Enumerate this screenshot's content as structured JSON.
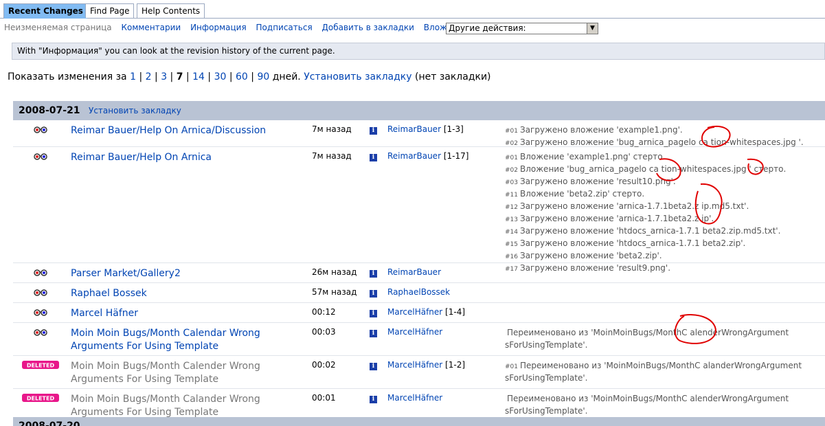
{
  "tabs": [
    "Recent Changes",
    "Find Page",
    "Help Contents"
  ],
  "actions": {
    "immutable": "Неизменяемая страница",
    "comments": "Комментарии",
    "info": "Информация",
    "subscribe": "Подписаться",
    "bookmark": "Добавить в закладки",
    "attachments": "Вложения",
    "more_actions": "Другие действия:"
  },
  "infobox": "With \"Информация\" you can look at the revision history of the current page.",
  "showline": {
    "prefix": "Показать изменения за",
    "days": [
      "1",
      "2",
      "3",
      "7",
      "14",
      "30",
      "60",
      "90"
    ],
    "current": "7",
    "suffix": "дней.",
    "set_bookmark": "Установить закладку",
    "no_bookmark": "(нет закладки)"
  },
  "day": {
    "date": "2008-07-21",
    "bookmark": "Установить закладку"
  },
  "rows": [
    {
      "title": "Reimar Bauer/Help On Arnica/Discussion",
      "deleted": false,
      "time": "7м назад",
      "editor": "ReimarBauer",
      "range": "[1-3]",
      "comments": [
        {
          "num": "#01",
          "text": "Загружено вложение 'example1.png'."
        },
        {
          "num": "#02",
          "text": "Загружено вложение 'bug_arnica_pagelo ca tion-whitespaces.jpg '."
        }
      ]
    },
    {
      "title": "Reimar Bauer/Help On Arnica",
      "deleted": false,
      "time": "7м назад",
      "editor": "ReimarBauer",
      "range": "[1-17]",
      "comments": [
        {
          "num": "#01",
          "text": "Вложение 'example1.png' стерто."
        },
        {
          "num": "#02",
          "text": "Вложение 'bug_arnica_pagelo ca tion-whitespaces.jpg ' стерто."
        },
        {
          "num": "#03",
          "text": "Загружено вложение 'result10.png'."
        },
        {
          "num": "#11",
          "text": "Вложение 'beta2.zip' стерто."
        },
        {
          "num": "#12",
          "text": "Загружено вложение 'arnica-1.7.1beta2.z ip.md5.txt'."
        },
        {
          "num": "#13",
          "text": "Загружено вложение 'arnica-1.7.1beta2.z ip'."
        },
        {
          "num": "#14",
          "text": "Загружено вложение 'htdocs_arnica-1.7.1 beta2.zip.md5.txt'."
        },
        {
          "num": "#15",
          "text": "Загружено вложение 'htdocs_arnica-1.7.1 beta2.zip'."
        },
        {
          "num": "#16",
          "text": "Загружено вложение 'beta2.zip'."
        },
        {
          "num": "#17",
          "text": "Загружено вложение 'result9.png'."
        }
      ]
    },
    {
      "title": "Parser Market/Gallery2",
      "deleted": false,
      "time": "26м назад",
      "editor": "ReimarBauer",
      "range": "",
      "comments": []
    },
    {
      "title": "Raphael Bossek",
      "deleted": false,
      "time": "57м назад",
      "editor": "RaphaelBossek",
      "range": "",
      "comments": []
    },
    {
      "title": "Marcel Häfner",
      "deleted": false,
      "time": "00:12",
      "editor": "MarcelHäfner",
      "range": "[1-4]",
      "comments": []
    },
    {
      "title": "Moin Moin Bugs/Month Calendar Wrong Arguments For Using Template",
      "deleted": false,
      "time": "00:03",
      "editor": "MarcelHäfner",
      "range": "",
      "comments": [
        {
          "num": "",
          "text": "Переименовано из 'MoinMoinBugs/MonthC alenderWrongArgument sForUsingTemplate'."
        }
      ]
    },
    {
      "title": "Moin Moin Bugs/Month Calender Wrong Arguments For Using Template",
      "deleted": true,
      "time": "00:02",
      "editor": "MarcelHäfner",
      "range": "[1-2]",
      "comments": [
        {
          "num": "#01",
          "text": "Переименовано из 'MoinMoinBugs/MonthC alanderWrongArgument sForUsingTemplate'."
        }
      ]
    },
    {
      "title": "Moin Moin Bugs/Month Calander Wrong Arguments For Using Template",
      "deleted": true,
      "time": "00:01",
      "editor": "MarcelHäfner",
      "range": "",
      "comments": [
        {
          "num": "",
          "text": "Переименовано из 'MoinMoinBugs/MonthC alenderWrongArgument sForUsingTemplate'."
        }
      ]
    }
  ],
  "next_day": "2008-07-20",
  "icons": {
    "diff": "diff-glasses-icon",
    "deleted": "deleted-badge-icon",
    "info": "info-icon"
  },
  "colors": {
    "link": "#0044b3",
    "active_tab": "#81bbf2",
    "day_header": "#b9c3d4",
    "scribble": "#e00000"
  }
}
